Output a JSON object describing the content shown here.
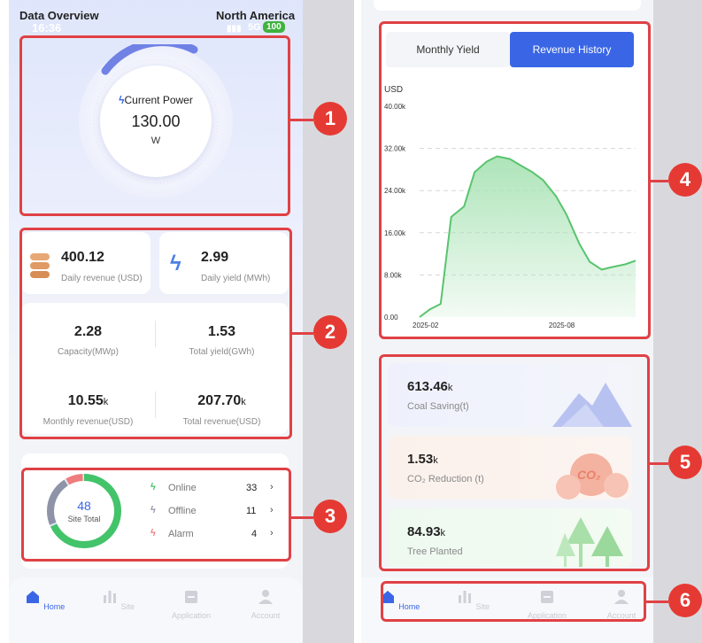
{
  "left": {
    "status": {
      "title": "Data Overview",
      "region": "North America",
      "time": "16:36",
      "network": "5G",
      "battery": "100"
    },
    "power": {
      "label": "Current Power",
      "value": "130.00",
      "unit": "W"
    },
    "stats": {
      "daily_revenue": {
        "value": "400.12",
        "label": "Daily revenue (USD)"
      },
      "daily_yield": {
        "value": "2.99",
        "label": "Daily yield (MWh)"
      },
      "capacity": {
        "value": "2.28",
        "label": "Capacity(MWp)"
      },
      "total_yield": {
        "value": "1.53",
        "label": "Total yield(GWh)"
      },
      "monthly_revenue": {
        "value": "10.55",
        "unit": "k",
        "label": "Monthly revenue(USD)"
      },
      "total_revenue": {
        "value": "207.70",
        "unit": "k",
        "label": "Total revenue(USD)"
      }
    },
    "sites": {
      "total": "48",
      "total_label": "Site Total",
      "rows": [
        {
          "label": "Online",
          "count": "33",
          "color": "#43c46a"
        },
        {
          "label": "Offline",
          "count": "11",
          "color": "#8f93a8"
        },
        {
          "label": "Alarm",
          "count": "4",
          "color": "#ee7d7d"
        }
      ]
    }
  },
  "right": {
    "battery": "100",
    "tabs": {
      "monthly": "Monthly Yield",
      "revenue": "Revenue History",
      "active": "revenue"
    },
    "environment": {
      "coal": {
        "value": "613.46",
        "unit": "k",
        "label": "Coal Saving(t)"
      },
      "co2": {
        "value": "1.53",
        "unit": "k",
        "label": "CO₂ Reduction (t)"
      },
      "trees": {
        "value": "84.93",
        "unit": "k",
        "label": "Tree Planted"
      }
    },
    "co2_badge": "CO₂"
  },
  "nav": {
    "items": [
      "Home",
      "Site",
      "Application",
      "Account"
    ],
    "active": "Home"
  },
  "markers": [
    "1",
    "2",
    "3",
    "4",
    "5",
    "6"
  ],
  "colors": {
    "accent": "#3a66e6",
    "highlight": "#e04145",
    "chart_line": "#59c46e",
    "chart_fill": "#a9e3b5"
  },
  "chart_data": {
    "type": "area",
    "ylabel": "USD",
    "yticks": [
      "0.00",
      "8.00k",
      "16.00k",
      "24.00k",
      "32.00k",
      "40.00k"
    ],
    "ylim": [
      0,
      40000
    ],
    "xticks": [
      "2025-02",
      "2025-08"
    ],
    "grid": true,
    "series": [
      {
        "x": [
          "2025-02-01",
          "2025-02-15",
          "2025-03-01",
          "2025-03-15",
          "2025-04-01",
          "2025-04-15",
          "2025-05-01",
          "2025-05-15",
          "2025-06-01",
          "2025-06-15",
          "2025-07-01",
          "2025-07-15",
          "2025-08-01",
          "2025-08-15",
          "2025-09-01",
          "2025-09-15",
          "2025-10-01",
          "2025-10-15",
          "2025-11-01",
          "2025-11-15"
        ],
        "values": [
          0,
          1500,
          2500,
          19000,
          21000,
          27500,
          29500,
          30500,
          30000,
          28800,
          27500,
          26000,
          23000,
          19500,
          14000,
          10500,
          9000,
          9500,
          10000,
          10700
        ]
      }
    ]
  }
}
